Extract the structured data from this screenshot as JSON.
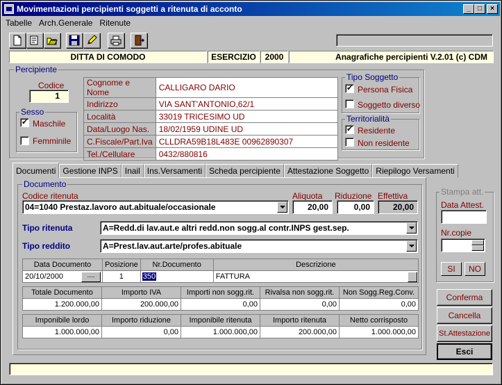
{
  "window": {
    "title": "Movimentazioni percipienti soggetti a ritenuta di acconto"
  },
  "menu": [
    "Tabelle",
    "Arch.Generale",
    "Ritenute"
  ],
  "toolbar": {
    "icons": [
      "new-doc-icon",
      "edit-doc-icon",
      "open-icon",
      "save-icon",
      "pencil-icon",
      "print-icon",
      "exit-door-icon"
    ]
  },
  "header": {
    "company": "DITTA DI COMODO",
    "esercizio_label": "ESERCIZIO",
    "year": "2000",
    "app_info": "Anagrafiche percipienti V.2.01 (c) CDM"
  },
  "percipiente": {
    "group_label": "Percipiente",
    "codice_label": "Codice",
    "codice": "1",
    "sesso_label": "Sesso",
    "maschile": "Maschile",
    "femminile": "Femminile",
    "fields": [
      {
        "label": "Cognome e Nome",
        "value": "CALLIGARO DARIO"
      },
      {
        "label": "Indirizzo",
        "value": "VIA SANT'ANTONIO,62/1"
      },
      {
        "label": "Località",
        "value": "33019 TRICESIMO UD"
      },
      {
        "label": "Data/Luogo Nas.",
        "value": "18/02/1959 UDINE UD"
      },
      {
        "label": "C.Fiscale/Part.Iva",
        "value": "CLLDRA59B18L483E 00962890307"
      },
      {
        "label": "Tel./Cellulare",
        "value": "0432/880816"
      }
    ],
    "tipo_soggetto_label": "Tipo Soggetto",
    "persona_fisica": "Persona Fisica",
    "soggetto_diverso": "Soggetto diverso",
    "territorialita_label": "Territorialità",
    "residente": "Residente",
    "non_residente": "Non residente"
  },
  "tabs": [
    "Documenti",
    "Gestione INPS",
    "Inail",
    "Ins.Versamenti",
    "Scheda percipiente",
    "Attestazione Soggetto",
    "Riepilogo Versamenti"
  ],
  "documento": {
    "group_label": "Documento",
    "codice_ritenuta_label": "Codice ritenuta",
    "codice_ritenuta": "04=1040 Prestaz.lavoro aut.abituale/occasionale",
    "aliquota_label": "Aliquota",
    "aliquota": "20,00",
    "riduzione_label": "Riduzione",
    "riduzione": "0,00",
    "effettiva_label": "Effettiva",
    "effettiva": "20,00",
    "tipo_ritenuta_label": "Tipo ritenuta",
    "tipo_ritenuta": "A=Redd.di lav.aut.e altri redd.non sogg.al contr.INPS gest.sep.",
    "tipo_reddito_label": "Tipo reddito",
    "tipo_reddito": "A=Prest.lav.aut.arte/profes.abituale",
    "row1_headers": [
      "Data Documento",
      "Posizione",
      "Nr.Documento",
      "Descrizione"
    ],
    "data_documento": "20/10/2000",
    "date_btn": "....",
    "posizione": "1",
    "nr_documento": "350",
    "descrizione": "FATTURA",
    "row2_headers": [
      "Totale Documento",
      "Importo IVA",
      "Importi non sogg.rit.",
      "Rivalsa non sogg.rit.",
      "Non Sogg.Reg.Conv."
    ],
    "row2_values": [
      "1.200.000,00",
      "200.000,00",
      "0,00",
      "0,00",
      "0,00"
    ],
    "row3_headers": [
      "Imponibile lordo",
      "Importo riduzione",
      "Imponibile ritenuta",
      "Importo ritenuta",
      "Netto corrisposto"
    ],
    "row3_values": [
      "1.000.000,00",
      "0,00",
      "1.000.000,00",
      "200.000,00",
      "1.000.000,00"
    ]
  },
  "stampa": {
    "group_label": "Stampa att.",
    "data_attest_label": "Data Attest.",
    "nr_copie_label": "Nr.copie",
    "si": "SI",
    "no": "NO"
  },
  "buttons": {
    "conferma": "Conferma",
    "cancella": "Cancella",
    "st_attestazione": "St.Attestazione",
    "esci": "Esci"
  }
}
